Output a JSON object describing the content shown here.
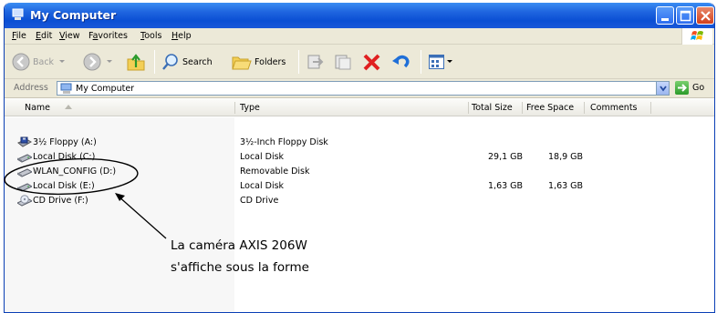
{
  "window": {
    "title": "My Computer"
  },
  "menu": [
    "File",
    "Edit",
    "View",
    "Favorites",
    "Tools",
    "Help"
  ],
  "menu_mnemonic": [
    "F",
    "E",
    "V",
    "a",
    "T",
    "H"
  ],
  "toolbar": {
    "back": "Back",
    "search": "Search",
    "folders": "Folders"
  },
  "address": {
    "label": "Address",
    "value": "My Computer",
    "go": "Go"
  },
  "columns": {
    "name": "Name",
    "type": "Type",
    "total": "Total Size",
    "free": "Free Space",
    "comments": "Comments"
  },
  "rows": [
    {
      "name": "3½ Floppy (A:)",
      "type": "3½-Inch Floppy Disk",
      "total": "",
      "free": "",
      "icon": "floppy-drive-icon"
    },
    {
      "name": "Local Disk (C:)",
      "type": "Local Disk",
      "total": "29,1 GB",
      "free": "18,9 GB",
      "icon": "hard-disk-icon"
    },
    {
      "name": "WLAN_CONFIG (D:)",
      "type": "Removable Disk",
      "total": "",
      "free": "",
      "icon": "removable-disk-icon"
    },
    {
      "name": "Local Disk (E:)",
      "type": "Local Disk",
      "total": "1,63 GB",
      "free": "1,63 GB",
      "icon": "hard-disk-icon"
    },
    {
      "name": "CD Drive (F:)",
      "type": "CD Drive",
      "total": "",
      "free": "",
      "icon": "cd-drive-icon"
    }
  ],
  "annotation": {
    "line1": "La caméra AXIS 206W",
    "line2": "s'affiche sous la forme"
  },
  "colors": {
    "titlebar": "#0b4fd4",
    "chrome": "#ece9d8",
    "close": "#d3411d"
  }
}
